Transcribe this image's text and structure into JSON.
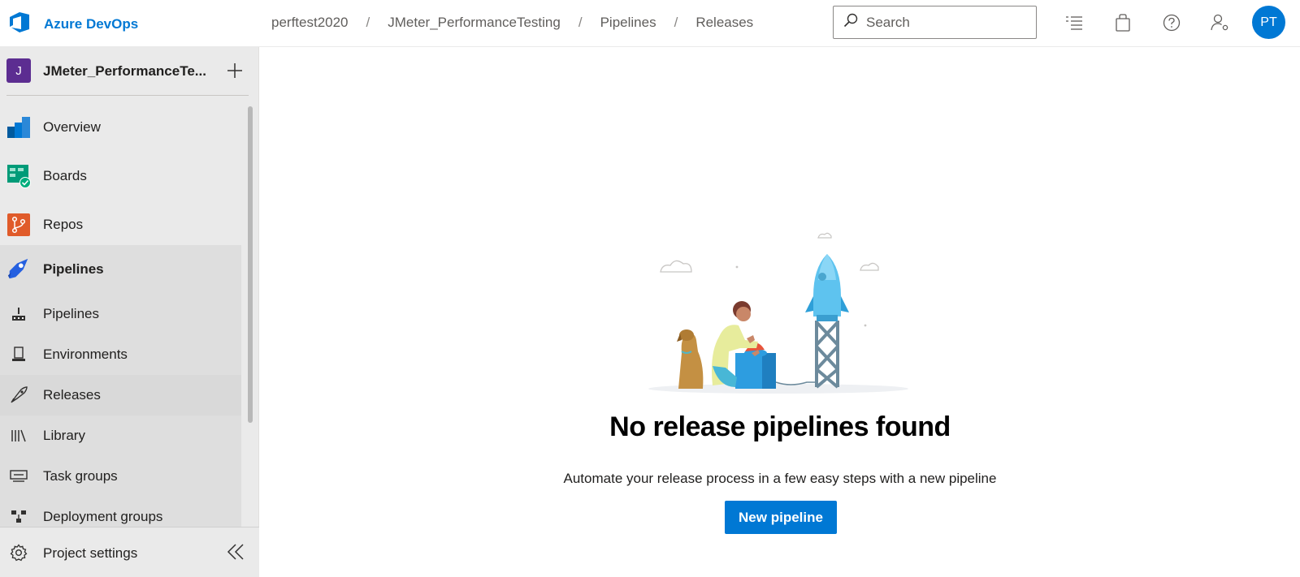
{
  "header": {
    "brand": "Azure DevOps",
    "breadcrumbs": [
      "perftest2020",
      "JMeter_PerformanceTesting",
      "Pipelines",
      "Releases"
    ],
    "search_placeholder": "Search",
    "avatar_initials": "PT"
  },
  "sidebar": {
    "project_initial": "J",
    "project_name": "JMeter_PerformanceTe...",
    "items": [
      {
        "label": "Overview",
        "icon": "overview-icon"
      },
      {
        "label": "Boards",
        "icon": "boards-icon"
      },
      {
        "label": "Repos",
        "icon": "repos-icon"
      },
      {
        "label": "Pipelines",
        "icon": "pipelines-icon"
      }
    ],
    "subitems": [
      {
        "label": "Pipelines",
        "icon": "pipelines-sub-icon"
      },
      {
        "label": "Environments",
        "icon": "environments-icon"
      },
      {
        "label": "Releases",
        "icon": "releases-icon",
        "selected": true
      },
      {
        "label": "Library",
        "icon": "library-icon"
      },
      {
        "label": "Task groups",
        "icon": "task-groups-icon"
      },
      {
        "label": "Deployment groups",
        "icon": "deployment-groups-icon"
      }
    ],
    "settings_label": "Project settings"
  },
  "main": {
    "empty_title": "No release pipelines found",
    "empty_description": "Automate your release process in a few easy steps with a new pipeline",
    "new_pipeline_label": "New pipeline"
  },
  "colors": {
    "accent": "#0078d4",
    "project_badge": "#5c2d91",
    "sidebar_bg": "#eaeaea"
  }
}
